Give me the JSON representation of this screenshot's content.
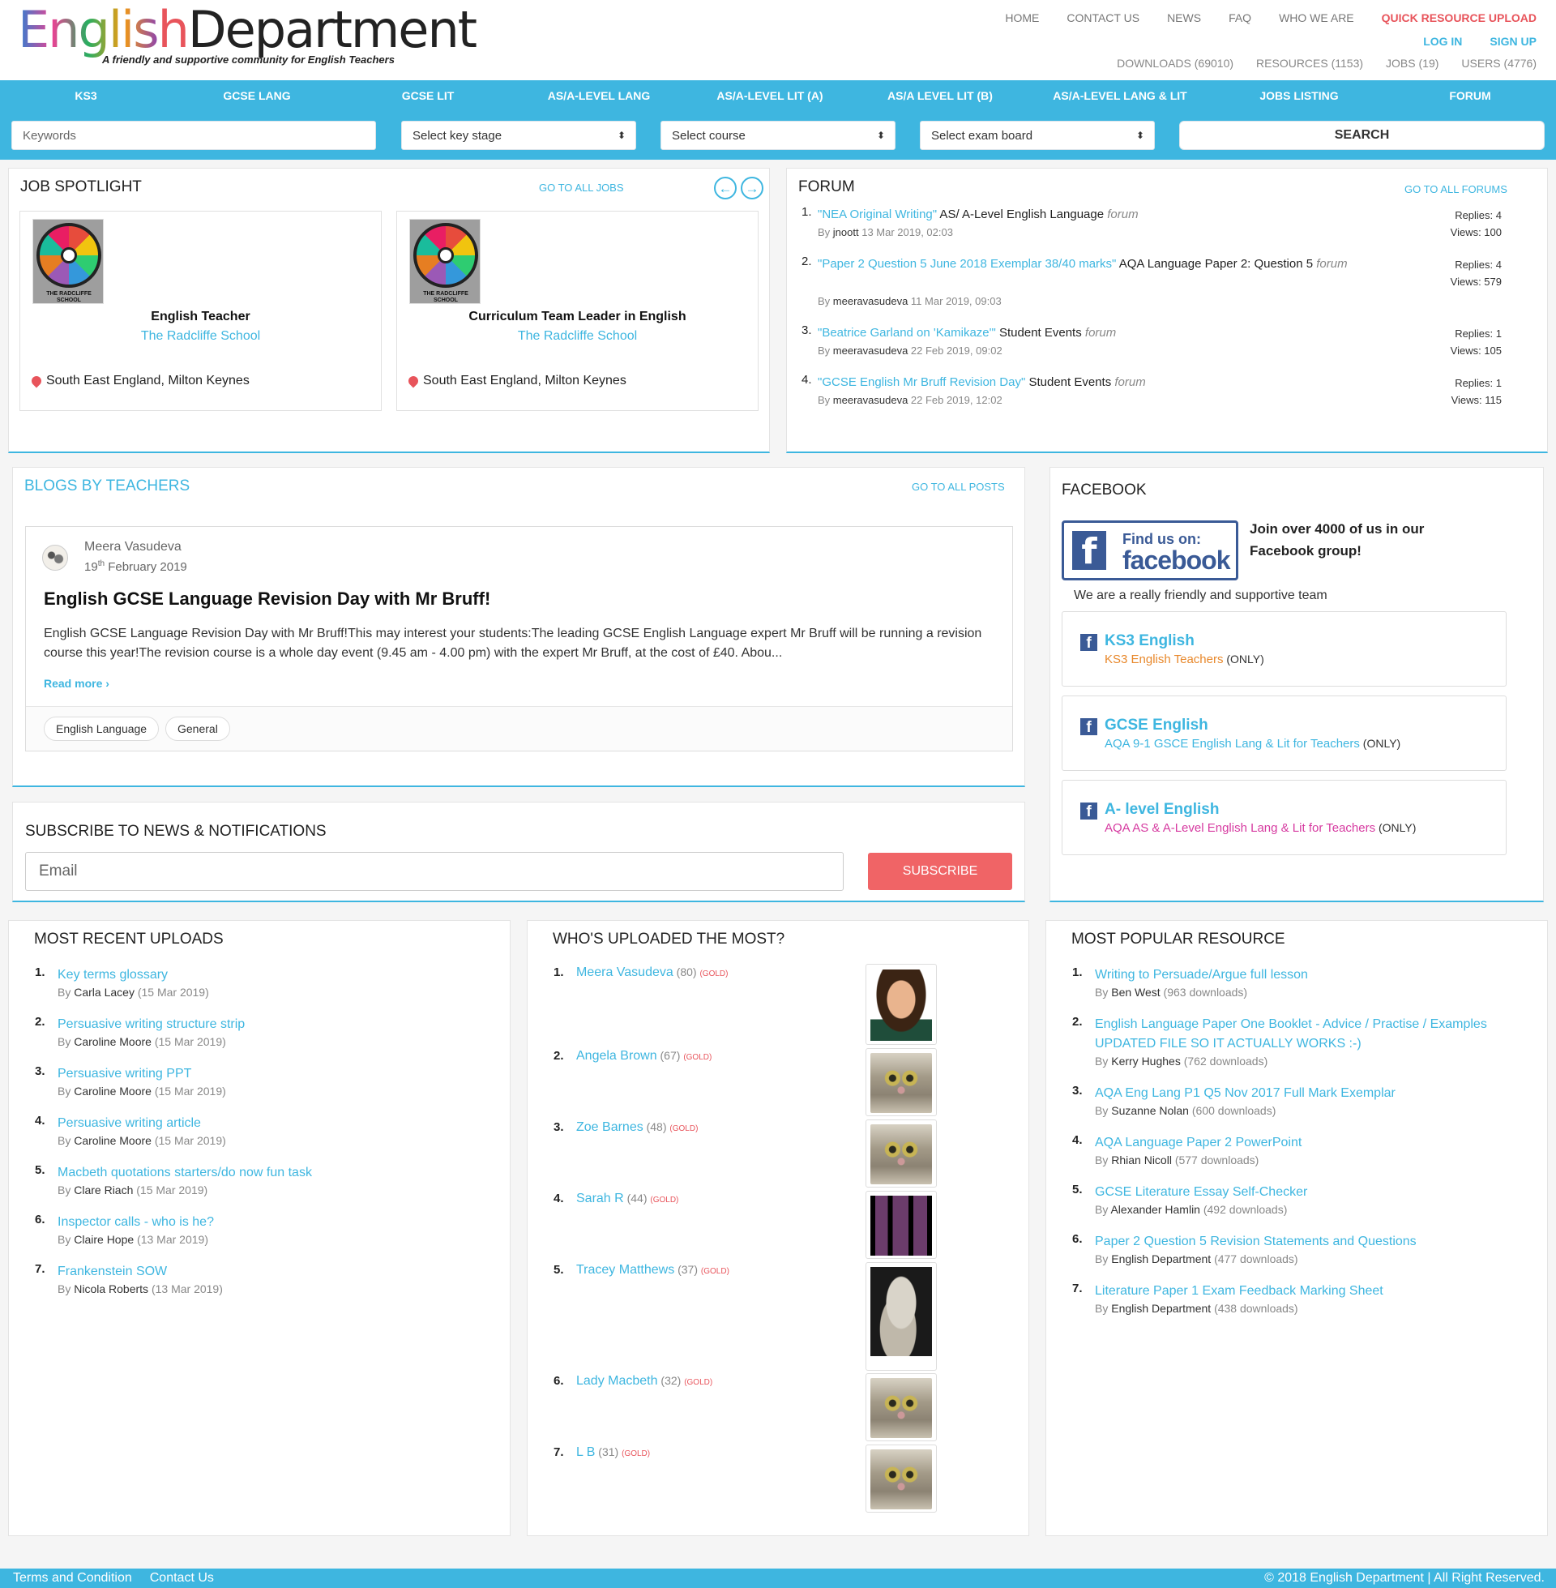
{
  "logo": {
    "part1": "Englis",
    "part2": "h",
    "part3": "Department",
    "tagline": "A friendly and supportive community for English Teachers"
  },
  "topnav": [
    "HOME",
    "CONTACT US",
    "NEWS",
    "FAQ",
    "WHO WE ARE",
    "QUICK RESOURCE UPLOAD"
  ],
  "authnav": {
    "login": "LOG IN",
    "signup": "SIGN UP"
  },
  "stats": [
    "DOWNLOADS (69010)",
    "RESOURCES (1153)",
    "JOBS (19)",
    "USERS (4776)"
  ],
  "mainnav": [
    "KS3",
    "GCSE LANG",
    "GCSE LIT",
    "AS/A-LEVEL LANG",
    "AS/A-LEVEL LIT (A)",
    "AS/A LEVEL LIT (B)",
    "AS/A-LEVEL LANG & LIT",
    "JOBS LISTING",
    "FORUM"
  ],
  "search": {
    "keywords_placeholder": "Keywords",
    "key_stage": "Select key stage",
    "course": "Select course",
    "exam_board": "Select exam board",
    "button": "SEARCH"
  },
  "jobs": {
    "title": "JOB SPOTLIGHT",
    "link": "GO TO ALL JOBS",
    "items": [
      {
        "title": "English Teacher",
        "school": "The Radcliffe School",
        "location": "South East England, Milton Keynes",
        "logo_text": "THE RADCLIFFE SCHOOL"
      },
      {
        "title": "Curriculum Team Leader in English",
        "school": "The Radcliffe School",
        "location": "South East England, Milton Keynes",
        "logo_text": "THE RADCLIFFE SCHOOL"
      }
    ]
  },
  "forum": {
    "title": "FORUM",
    "link": "GO TO ALL FORUMS",
    "items": [
      {
        "num": "1.",
        "topic": "\"NEA Original Writing\"",
        "board": " AS/ A-Level English Language ",
        "forum_word": "forum",
        "by": "By ",
        "user": "jnoott",
        "date": " 13 Mar 2019, 02:03",
        "replies": "Replies: 4",
        "views": "Views: 100"
      },
      {
        "num": "2.",
        "topic": "\"Paper 2 Question 5 June 2018 Exemplar 38/40 marks\"",
        "board": " AQA Language Paper 2: Question 5 ",
        "forum_word": "forum",
        "by": "By ",
        "user": "meeravasudeva",
        "date": " 11 Mar 2019, 09:03",
        "replies": "Replies: 4",
        "views": "Views: 579"
      },
      {
        "num": "3.",
        "topic": "\"Beatrice Garland on 'Kamikaze'\"",
        "board": " Student Events ",
        "forum_word": "forum",
        "by": "By ",
        "user": "meeravasudeva",
        "date": " 22 Feb 2019, 09:02",
        "replies": "Replies: 1",
        "views": "Views: 105"
      },
      {
        "num": "4.",
        "topic": "\"GCSE English Mr Bruff Revision Day\"",
        "board": " Student Events ",
        "forum_word": "forum",
        "by": "By ",
        "user": "meeravasudeva",
        "date": " 22 Feb 2019, 12:02",
        "replies": "Replies: 1",
        "views": "Views: 115"
      }
    ]
  },
  "blogs": {
    "title": "BLOGS BY TEACHERS",
    "link": "GO TO ALL POSTS",
    "post": {
      "author": "Meera Vasudeva",
      "day": "19",
      "day_suffix": "th",
      "month_year": " February 2019",
      "title": "English GCSE Language Revision Day with Mr Bruff!",
      "excerpt": "English GCSE Language Revision Day with Mr Bruff!This may interest your students:The leading GCSE English Language expert Mr Bruff will be running a revision course this year!The revision course is a whole day event (9.45 am - 4.00 pm) with the expert Mr Bruff, at the cost of £40. Abou...",
      "read_more": "Read more ›",
      "tags": [
        "English Language",
        "General"
      ]
    }
  },
  "subscribe": {
    "title": "SUBSCRIBE TO NEWS & NOTIFICATIONS",
    "placeholder": "Email",
    "button": "SUBSCRIBE"
  },
  "facebook": {
    "title": "FACEBOOK",
    "banner_find": "Find us on:",
    "banner_brand": "facebook",
    "join": "Join over 4000 of us in our Facebook group!",
    "team": "We are a really friendly and supportive team",
    "groups": [
      {
        "name": "KS3 English",
        "sub": "KS3 English Teachers",
        "only": " (ONLY)",
        "color": "#e8882b"
      },
      {
        "name": "GCSE English",
        "sub": "AQA 9-1 GSCE English Lang & Lit for Teachers",
        "only": " (ONLY)",
        "color": "#3eb6e0"
      },
      {
        "name": "A- level English",
        "sub": "AQA AS & A-Level English Lang & Lit for Teachers",
        "only": " (ONLY)",
        "color": "#d63aa0"
      }
    ]
  },
  "recent": {
    "title": "MOST RECENT UPLOADS",
    "items": [
      {
        "num": "1.",
        "title": "Key terms glossary",
        "by": "By ",
        "user": "Carla Lacey",
        "date": " (15 Mar 2019)"
      },
      {
        "num": "2.",
        "title": "Persuasive writing structure strip",
        "by": "By ",
        "user": "Caroline Moore",
        "date": " (15 Mar 2019)"
      },
      {
        "num": "3.",
        "title": "Persuasive writing PPT",
        "by": "By ",
        "user": "Caroline Moore",
        "date": " (15 Mar 2019)"
      },
      {
        "num": "4.",
        "title": "Persuasive writing article",
        "by": "By ",
        "user": "Caroline Moore",
        "date": " (15 Mar 2019)"
      },
      {
        "num": "5.",
        "title": "Macbeth quotations starters/do now fun task",
        "by": "By ",
        "user": "Clare Riach",
        "date": " (15 Mar 2019)"
      },
      {
        "num": "6.",
        "title": "Inspector calls - who is he?",
        "by": "By ",
        "user": "Claire Hope",
        "date": " (13 Mar 2019)"
      },
      {
        "num": "7.",
        "title": "Frankenstein SOW",
        "by": "By ",
        "user": "Nicola Roberts",
        "date": " (13 Mar 2019)"
      }
    ]
  },
  "uploaders": {
    "title": "WHO'S UPLOADED THE MOST?",
    "items": [
      {
        "num": "1.",
        "name": "Meera Vasudeva",
        "count": " (80) ",
        "badge": "(GOLD)"
      },
      {
        "num": "2.",
        "name": "Angela Brown",
        "count": " (67) ",
        "badge": "(GOLD)"
      },
      {
        "num": "3.",
        "name": "Zoe Barnes",
        "count": " (48) ",
        "badge": "(GOLD)"
      },
      {
        "num": "4.",
        "name": "Sarah R",
        "count": " (44) ",
        "badge": "(GOLD)"
      },
      {
        "num": "5.",
        "name": "Tracey Matthews",
        "count": " (37) ",
        "badge": "(GOLD)"
      },
      {
        "num": "6.",
        "name": "Lady Macbeth",
        "count": " (32) ",
        "badge": "(GOLD)"
      },
      {
        "num": "7.",
        "name": "L B",
        "count": " (31) ",
        "badge": "(GOLD)"
      }
    ]
  },
  "popular": {
    "title": "MOST POPULAR RESOURCE",
    "items": [
      {
        "num": "1.",
        "title": "Writing to Persuade/Argue full lesson",
        "title2": "",
        "by": "By ",
        "user": "Ben West",
        "dl": " (963 downloads)"
      },
      {
        "num": "2.",
        "title": "English Language Paper One Booklet - Advice / Practise / Examples",
        "title2": " UPDATED FILE SO IT ACTUALLY WORKS :-)",
        "by": "By ",
        "user": "Kerry Hughes",
        "dl": " (762 downloads)"
      },
      {
        "num": "3.",
        "title": "AQA Eng Lang P1 Q5 Nov 2017 Full Mark Exemplar",
        "title2": "",
        "by": "By ",
        "user": "Suzanne Nolan",
        "dl": " (600 downloads)"
      },
      {
        "num": "4.",
        "title": "AQA Language Paper 2 PowerPoint",
        "title2": "",
        "by": "By ",
        "user": "Rhian Nicoll",
        "dl": " (577 downloads)"
      },
      {
        "num": "5.",
        "title": "GCSE Literature Essay Self-Checker",
        "title2": "",
        "by": "By ",
        "user": "Alexander Hamlin",
        "dl": " (492 downloads)"
      },
      {
        "num": "6.",
        "title": "Paper 2 Question 5 Revision Statements and Questions",
        "title2": "",
        "by": "By ",
        "user": "English Department",
        "dl": " (477 downloads)"
      },
      {
        "num": "7.",
        "title": "Literature Paper 1 Exam Feedback Marking Sheet",
        "title2": "",
        "by": "By ",
        "user": "English Department",
        "dl": " (438 downloads)"
      }
    ]
  },
  "footer": {
    "terms": "Terms and Condition",
    "contact": "Contact Us",
    "copyright": "© 2018 English Department | All Right Reserved."
  },
  "colors": {
    "accent": "#3eb6e0",
    "danger": "#e8545b",
    "facebook": "#3a5a96"
  },
  "icons": [
    "map-pin-icon",
    "arrow-left-icon",
    "arrow-right-icon",
    "facebook-icon"
  ]
}
